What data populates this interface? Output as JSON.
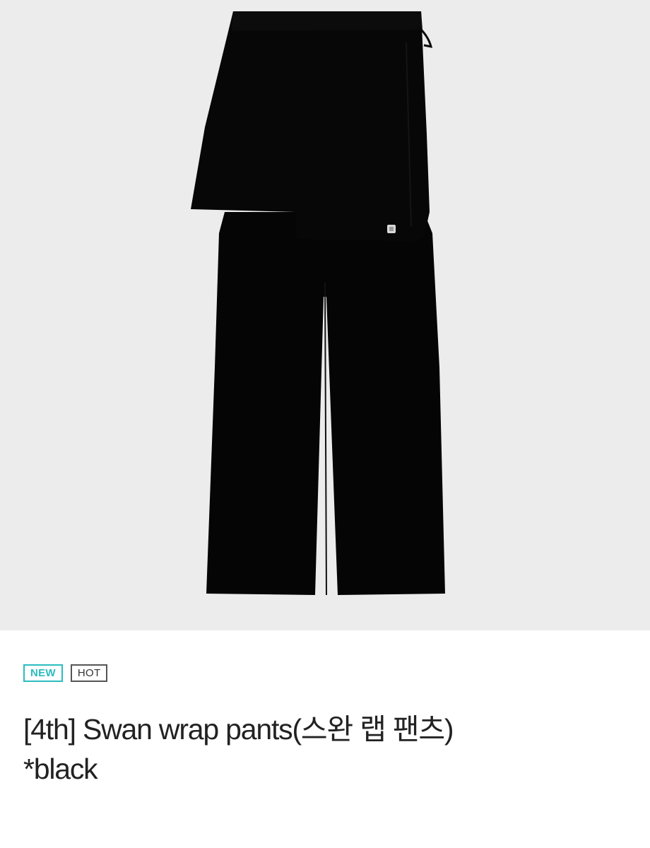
{
  "product": {
    "image_alt": "black wrap pants",
    "badges": {
      "new": "NEW",
      "hot": "HOT"
    },
    "title_line1": "[4th] Swan wrap pants(스완 랩 팬츠)",
    "title_line2": "*black"
  },
  "colors": {
    "image_background": "#ececec",
    "badge_new": "#2bbcc0",
    "badge_hot": "#555555",
    "title_text": "#222222",
    "garment": "#050505"
  }
}
